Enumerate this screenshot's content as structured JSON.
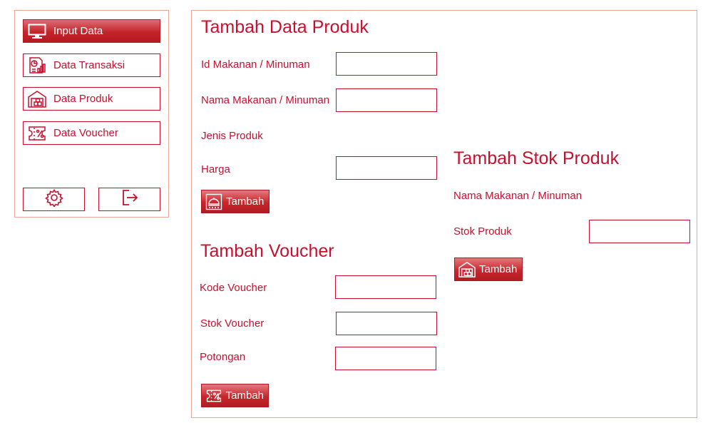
{
  "sidebar": {
    "items": [
      {
        "label": "Input Data",
        "icon": "monitor-icon",
        "active": true
      },
      {
        "label": "Data Transaksi",
        "icon": "report-chart-icon"
      },
      {
        "label": "Data Produk",
        "icon": "warehouse-icon"
      },
      {
        "label": "Data Voucher",
        "icon": "voucher-percent-icon"
      }
    ],
    "bottom_icons": [
      "gear-icon",
      "logout-icon"
    ]
  },
  "produk": {
    "title": "Tambah Data Produk",
    "fields": {
      "id": "Id Makanan / Minuman",
      "nama": "Nama Makanan / Minuman",
      "jenis": "Jenis Produk",
      "harga": "Harga"
    },
    "button": "Tambah"
  },
  "voucher": {
    "title": "Tambah Voucher",
    "fields": {
      "kode": "Kode Voucher",
      "stok": "Stok Voucher",
      "potongan": "Potongan"
    },
    "button": "Tambah"
  },
  "stok": {
    "title": "Tambah Stok Produk",
    "fields": {
      "nama": "Nama Makanan / Minuman",
      "stok": "Stok Produk"
    },
    "button": "Tambah"
  },
  "colors": {
    "accent": "#c8102e",
    "border_light": "#e8a896"
  }
}
